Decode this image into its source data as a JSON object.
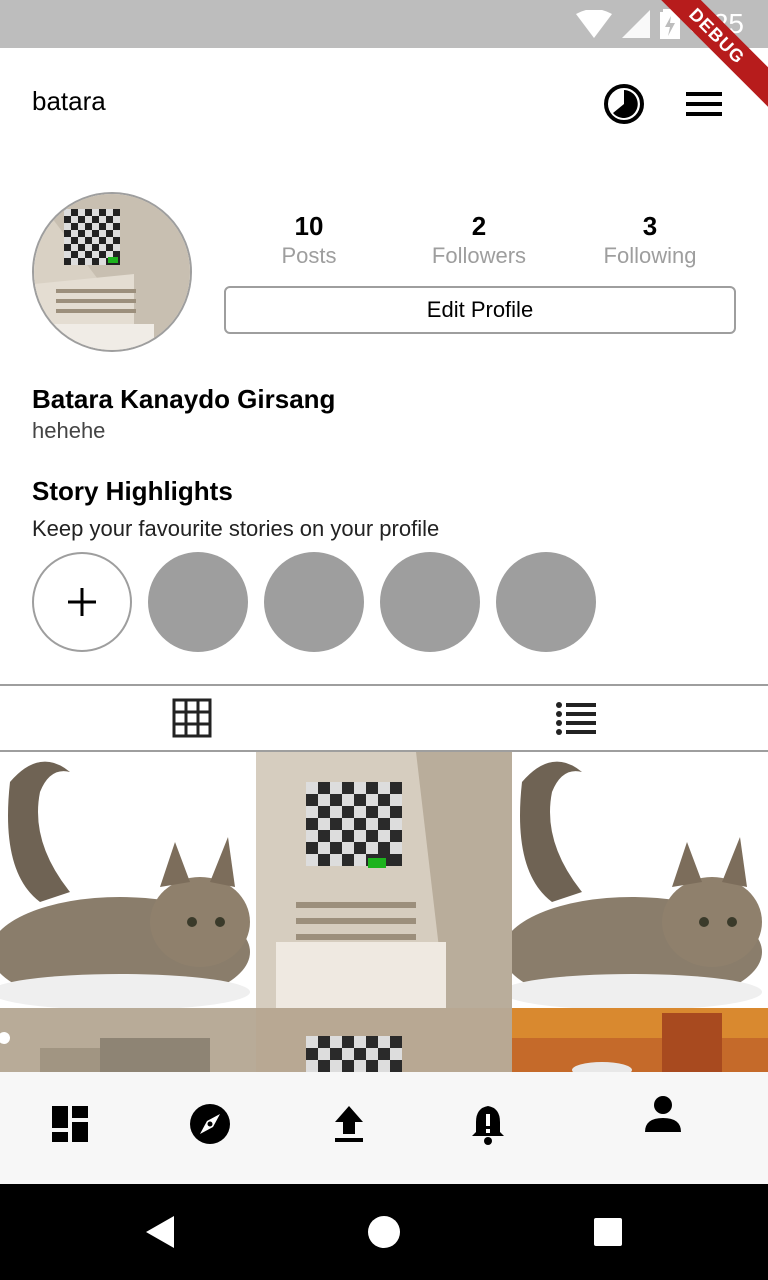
{
  "status_bar": {
    "time": "3:25",
    "debug_label": "DEBUG"
  },
  "header": {
    "username": "batara",
    "history_icon": "history-icon",
    "menu_icon": "hamburger-menu-icon"
  },
  "profile": {
    "stats": [
      {
        "value": "10",
        "label": "Posts"
      },
      {
        "value": "2",
        "label": "Followers"
      },
      {
        "value": "3",
        "label": "Following"
      }
    ],
    "edit_button": "Edit Profile",
    "full_name": "Batara Kanaydo Girsang",
    "bio": "hehehe"
  },
  "highlights": {
    "title": "Story Highlights",
    "subtitle": "Keep your favourite stories on your profile",
    "add_icon": "plus-icon",
    "placeholder_count": 4
  },
  "tabs": [
    {
      "icon": "grid-icon"
    },
    {
      "icon": "list-icon"
    }
  ],
  "posts": [
    "cat",
    "room-ceiling",
    "cat",
    "room-kitchen",
    "room-ceiling",
    "city-fire"
  ],
  "bottom_nav": [
    "dashboard-icon",
    "explore-compass-icon",
    "upload-icon",
    "notifications-icon",
    "profile-person-icon"
  ],
  "colors": {
    "status_bar": "#bdbdbd",
    "gray": "#9e9e9e",
    "debug_ribbon": "#b71c1c",
    "nav_bg": "#f7f7f7"
  }
}
